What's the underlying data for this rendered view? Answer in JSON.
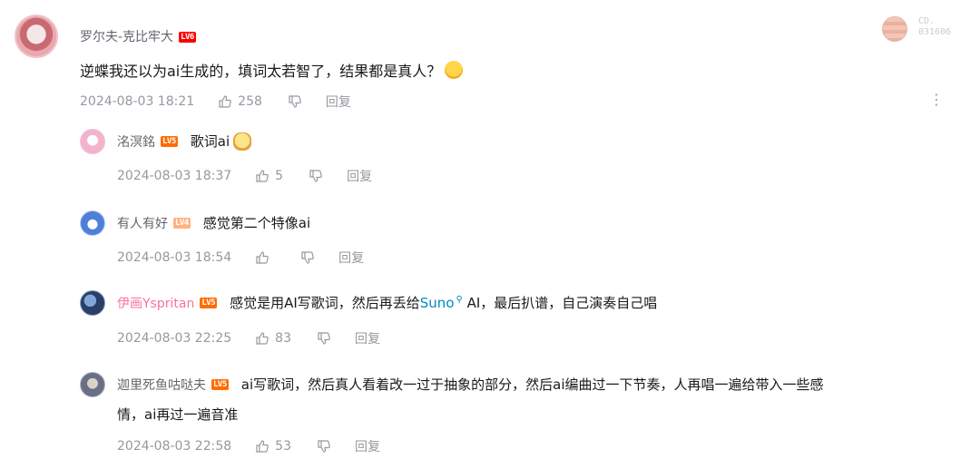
{
  "main_comment": {
    "username": "罗尔夫-克比牢大",
    "level": "LV6",
    "text": "逆蝶我还以为ai生成的，填词太若智了，结果都是真人？",
    "time": "2024-08-03 18:21",
    "likes": "258",
    "reply_label": "回复",
    "badge_text_1": "CD.",
    "badge_text_2": "031606"
  },
  "replies": [
    {
      "username": "洺溟銘",
      "level": "LV5",
      "text": "歌词ai",
      "time": "2024-08-03 18:37",
      "likes": "5",
      "reply_label": "回复"
    },
    {
      "username": "有人有好",
      "level": "LV4",
      "text": "感觉第二个特像ai",
      "time": "2024-08-03 18:54",
      "likes": "",
      "reply_label": "回复"
    },
    {
      "username": "伊画Yspritan",
      "level": "LV5",
      "text_before": "感觉是用AI写歌词，然后再丢给",
      "link_text": "Suno",
      "text_after": " AI，最后扒谱，自己演奏自己唱",
      "time": "2024-08-03 22:25",
      "likes": "83",
      "reply_label": "回复"
    },
    {
      "username": "迦里死鱼咕哒夫",
      "level": "LV5",
      "text_line1": "ai写歌词，然后真人看着改一过于抽象的部分，然后ai编曲过一下节奏，人再唱一遍给带入一些感",
      "text_line2": "情，ai再过一遍音准",
      "time": "2024-08-03 22:58",
      "likes": "53",
      "reply_label": "回复"
    }
  ]
}
